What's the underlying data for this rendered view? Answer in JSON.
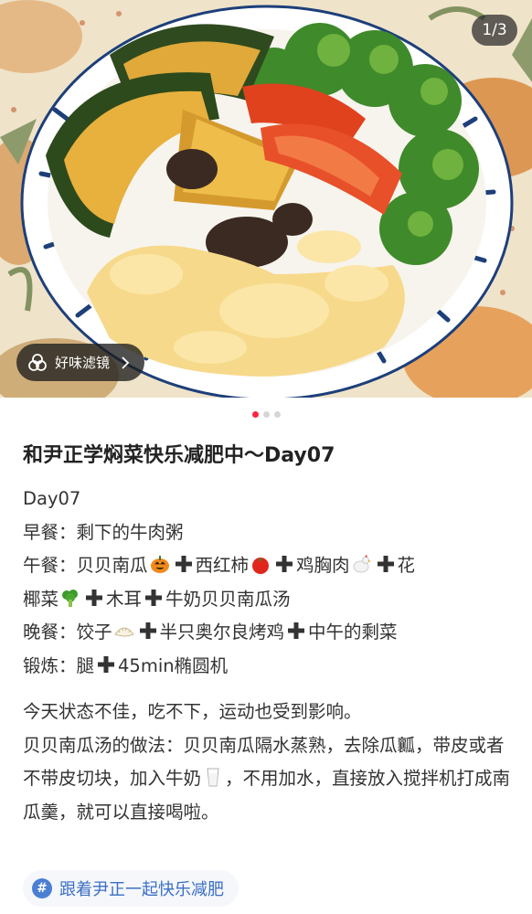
{
  "photo": {
    "alt_subject": "bowl of pumpkin, tomato, broccoli, egg and wood-ear mushroom",
    "counter": "1/3",
    "filter_label": "好味滤镜"
  },
  "pager": {
    "count": 3,
    "active_index": 0
  },
  "post": {
    "title": "和尹正学焖菜快乐减肥中～Day07",
    "lines": {
      "day": "Day07",
      "breakfast_prefix": "早餐：剩下的牛肉粥",
      "lunch_1": "午餐：贝贝南瓜",
      "lunch_2": "西红柿",
      "lunch_3": "鸡胸肉",
      "lunch_4": "花",
      "lunch_5": "椰菜",
      "lunch_6": "木耳",
      "lunch_7": "牛奶贝贝南瓜汤",
      "dinner_1": "晚餐：饺子",
      "dinner_2": "半只奥尔良烤鸡",
      "dinner_3": "中午的剩菜",
      "exercise_1": "锻炼：腿",
      "exercise_2": "45min椭圆机"
    },
    "para1": "今天状态不佳，吃不下，运动也受到影响。",
    "para2_a": "贝贝南瓜汤的做法：贝贝南瓜隔水蒸熟，去除瓜瓤，带皮或者不带皮切块，加入牛奶",
    "para2_b": "，不用加水，直接放入搅拌机打成南瓜羹，就可以直接喝啦。"
  },
  "tag": {
    "icon": "#",
    "label": "跟着尹正一起快乐减肥"
  },
  "colors": {
    "accent_dot": "#ff2442",
    "tag_text": "#3a6fc4",
    "tag_bg": "#f5f7fb"
  }
}
